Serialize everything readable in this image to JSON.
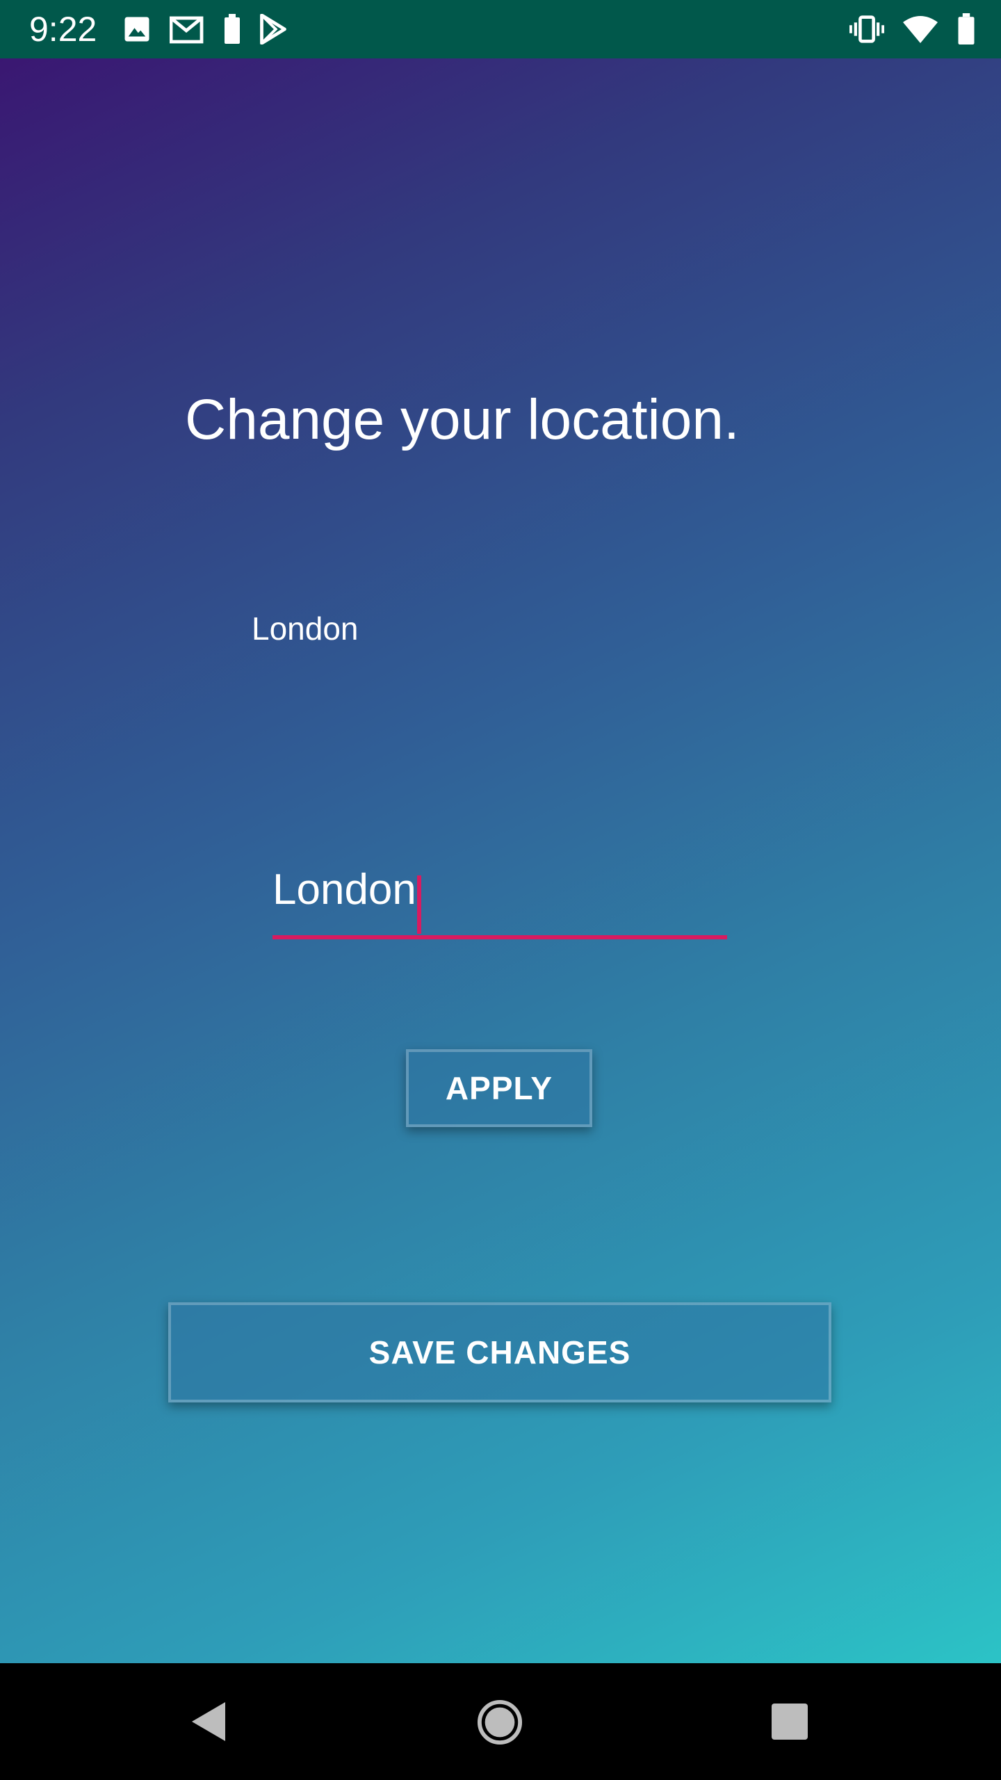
{
  "status_bar": {
    "time": "9:22",
    "left_icons": [
      "image-icon",
      "gmail-icon",
      "battery-icon",
      "play-store-icon"
    ],
    "right_icons": [
      "vibrate-icon",
      "wifi-icon",
      "battery-icon"
    ],
    "background_color": "#01584b"
  },
  "main": {
    "headline": "Change your location.",
    "current_location": "London",
    "location_input": {
      "value": "London",
      "placeholder": ""
    },
    "apply_label": "APPLY",
    "save_label": "SAVE CHANGES",
    "accent_color": "#d81b60",
    "gradient": [
      "#3a1772",
      "#2cc3c6"
    ]
  },
  "nav_bar": {
    "icons": [
      "back-icon",
      "home-icon",
      "recents-icon"
    ]
  }
}
